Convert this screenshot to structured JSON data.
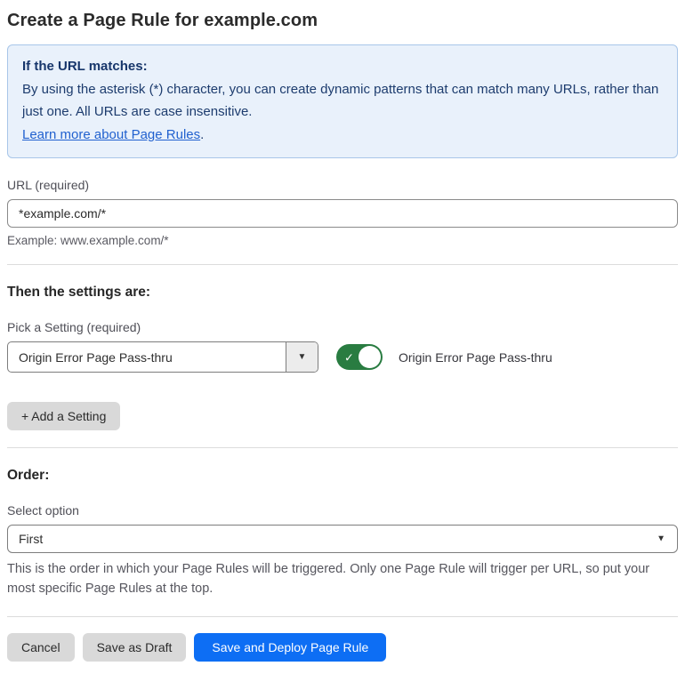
{
  "page": {
    "title": "Create a Page Rule for example.com"
  },
  "info_box": {
    "heading": "If the URL matches:",
    "body": "By using the asterisk (*) character, you can create dynamic patterns that can match many URLs, rather than just one. All URLs are case insensitive.",
    "link_label": "Learn more about Page Rules",
    "link_suffix": "."
  },
  "url_section": {
    "label": "URL (required)",
    "value": "*example.com/*",
    "helper": "Example: www.example.com/*"
  },
  "settings_section": {
    "heading": "Then the settings are:",
    "picker_label": "Pick a Setting (required)",
    "picker_value": "Origin Error Page Pass-thru",
    "toggle_state": "on",
    "toggle_label": "Origin Error Page Pass-thru",
    "add_setting_label": "+ Add a Setting"
  },
  "order_section": {
    "heading": "Order:",
    "select_label": "Select option",
    "select_value": "First",
    "helper": "This is the order in which your Page Rules will be triggered. Only one Page Rule will trigger per URL, so put your most specific Page Rules at the top."
  },
  "footer": {
    "cancel_label": "Cancel",
    "save_draft_label": "Save as Draft",
    "save_deploy_label": "Save and Deploy Page Rule"
  },
  "icons": {
    "check_glyph": "✓",
    "dropdown_arrow_glyph": "▼"
  },
  "colors": {
    "info_bg": "#e9f1fb",
    "info_border": "#a8c6e9",
    "info_text": "#1d3c6e",
    "link_blue": "#2161cf",
    "toggle_green": "#297c41",
    "primary_blue": "#0d6ef4",
    "gray_button": "#d9d9d9"
  }
}
